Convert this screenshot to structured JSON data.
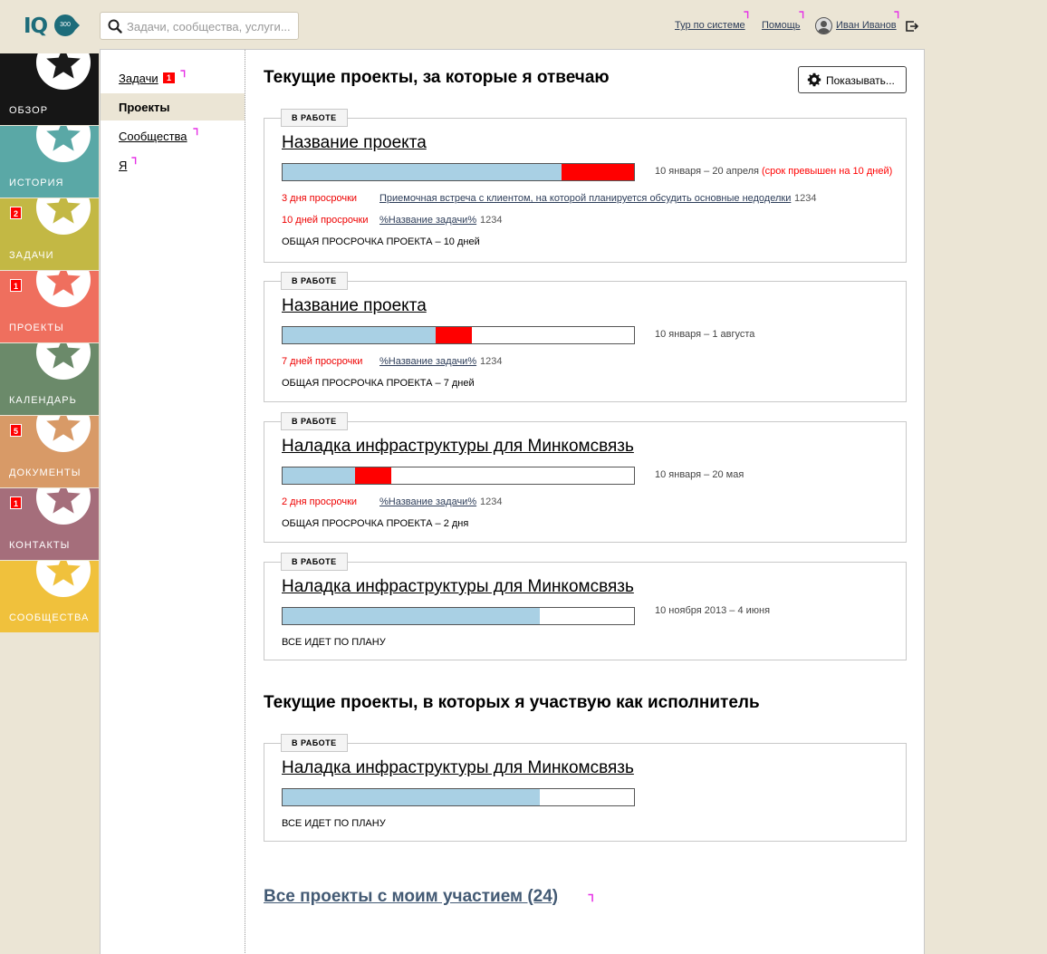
{
  "brand": {
    "logo_text": "IQ",
    "logo_badge": "300"
  },
  "search": {
    "placeholder": "Задачи, сообщества, услуги..."
  },
  "topbar": {
    "tour_label": "Тур по системе",
    "help_label": "Помощь",
    "user_name": "Иван Иванов"
  },
  "sidebar": {
    "items": [
      {
        "label": "ОБЗОР",
        "color": "#161616",
        "star": "#1a1a1a",
        "count": ""
      },
      {
        "label": "ИСТОРИЯ",
        "color": "#5aa8a6",
        "star": "#5aa8a6",
        "count": ""
      },
      {
        "label": "ЗАДАЧИ",
        "color": "#c3b844",
        "star": "#c3b844",
        "count": "2"
      },
      {
        "label": "ПРОЕКТЫ",
        "color": "#ef6f5e",
        "star": "#ef6f5e",
        "count": "1"
      },
      {
        "label": "КАЛЕНДАРЬ",
        "color": "#6b8a6a",
        "star": "#6b8a6a",
        "count": ""
      },
      {
        "label": "ДОКУМЕНТЫ",
        "color": "#d89a67",
        "star": "#d89a67",
        "count": "5"
      },
      {
        "label": "КОНТАКТЫ",
        "color": "#a56e7b",
        "star": "#a56e7b",
        "count": "1"
      },
      {
        "label": "СООБЩЕСТВА",
        "color": "#f0c13c",
        "star": "#f0c13c",
        "count": ""
      }
    ]
  },
  "subnav": {
    "items": [
      {
        "label": "Задачи",
        "count": "1"
      },
      {
        "label": "Проекты"
      },
      {
        "label": "Сообщества"
      },
      {
        "label": "Я"
      }
    ]
  },
  "main": {
    "heading_responsible": "Текущие проекты, за которые я отвечаю",
    "show_button": "Показывать...",
    "heading_executor": "Текущие проекты, в которых я участвую как исполнитель",
    "all_projects_link": "Все проекты с моим участием (24)",
    "projects": [
      {
        "status": "В РАБОТЕ",
        "name": "Название проекта",
        "progress_done": 0.795,
        "progress_over": 0.205,
        "dates": "10 января – 20 апреля",
        "overdue_note": "(срок превышен на 10 дней)",
        "delays": [
          {
            "delay": "3 дня просрочки",
            "task": "Приемочная встреча с клиентом, на которой планируется обсудить основные недоделки",
            "task_num": "1234"
          },
          {
            "delay": "10 дней просрочки",
            "task": "%Название задачи%",
            "task_num": "1234"
          }
        ],
        "total": "ОБЩАЯ ПРОСРОЧКА ПРОЕКТА – 10 дней"
      },
      {
        "status": "В РАБОТЕ",
        "name": "Название проекта",
        "progress_done": 0.436,
        "progress_over": 0.103,
        "dates": "10 января – 1 августа",
        "delays": [
          {
            "delay": "7 дней просрочки",
            "task": "%Название задачи%",
            "task_num": "1234"
          }
        ],
        "total": "ОБЩАЯ ПРОСРОЧКА ПРОЕКТА – 7 дней"
      },
      {
        "status": "В РАБОТЕ",
        "name": "Наладка инфраструктуры для Минкомсвязь",
        "progress_done": 0.205,
        "progress_over": 0.103,
        "dates": "10 января – 20 мая",
        "delays": [
          {
            "delay": "2 дня просрочки",
            "task": "%Название задачи%",
            "task_num": "1234"
          }
        ],
        "total": "ОБЩАЯ ПРОСРОЧКА ПРОЕКТА – 2 дня"
      },
      {
        "status": "В РАБОТЕ",
        "name": "Наладка инфраструктуры для Минкомсвязь",
        "progress_done": 0.733,
        "progress_over": 0,
        "dates": "10 ноября 2013 – 4 июня",
        "delays": [],
        "total": "ВСЕ ИДЕТ ПО ПЛАНУ"
      }
    ],
    "executor_projects": [
      {
        "status": "В РАБОТЕ",
        "name": "Наладка инфраструктуры для Минкомсвязь",
        "progress_done": 0.733,
        "progress_over": 0,
        "total": "ВСЕ ИДЕТ ПО ПЛАНУ"
      }
    ]
  }
}
